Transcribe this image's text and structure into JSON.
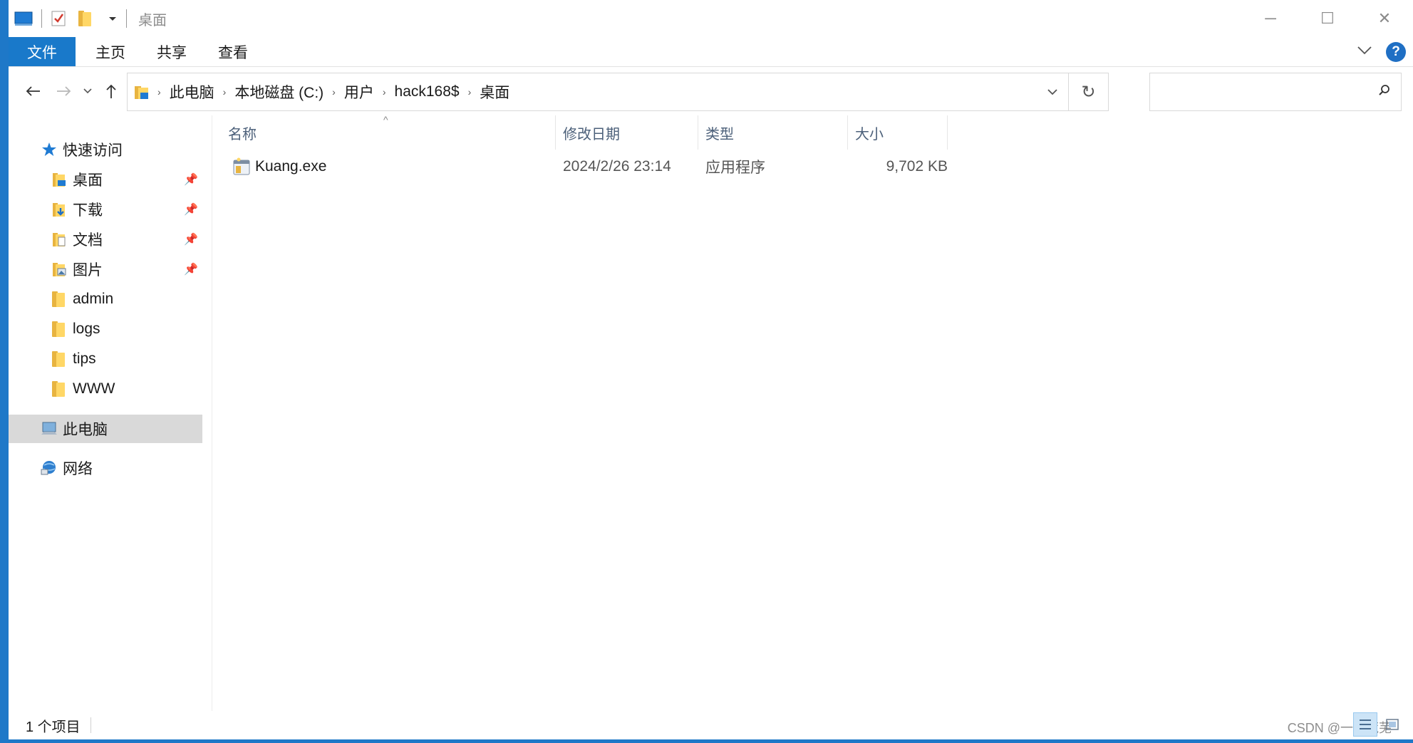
{
  "window": {
    "title": "桌面",
    "controls": {
      "minimize": "─",
      "maximize": "☐",
      "close": "✕"
    }
  },
  "ribbon": {
    "tabs": [
      {
        "label": "文件"
      },
      {
        "label": "主页"
      },
      {
        "label": "共享"
      },
      {
        "label": "查看"
      }
    ],
    "help": "?"
  },
  "address": {
    "crumbs": [
      "此电脑",
      "本地磁盘 (C:)",
      "用户",
      "hack168$",
      "桌面"
    ],
    "search_placeholder": ""
  },
  "nav": {
    "quick_access": "快速访问",
    "pinned": [
      {
        "label": "桌面"
      },
      {
        "label": "下载"
      },
      {
        "label": "文档"
      },
      {
        "label": "图片"
      }
    ],
    "folders": [
      {
        "label": "admin"
      },
      {
        "label": "logs"
      },
      {
        "label": "tips"
      },
      {
        "label": "WWW"
      }
    ],
    "this_pc": "此电脑",
    "network": "网络"
  },
  "columns": {
    "name": "名称",
    "modified": "修改日期",
    "type": "类型",
    "size": "大小"
  },
  "files": [
    {
      "name": "Kuang.exe",
      "modified": "2024/2/26 23:14",
      "type": "应用程序",
      "size": "9,702 KB"
    }
  ],
  "status": {
    "count": "1 个项目",
    "watermark": "CSDN @一纸荒芜"
  },
  "colors": {
    "accent": "#1979ca",
    "selection": "#d9d9d9",
    "header_text": "#4c607a"
  }
}
